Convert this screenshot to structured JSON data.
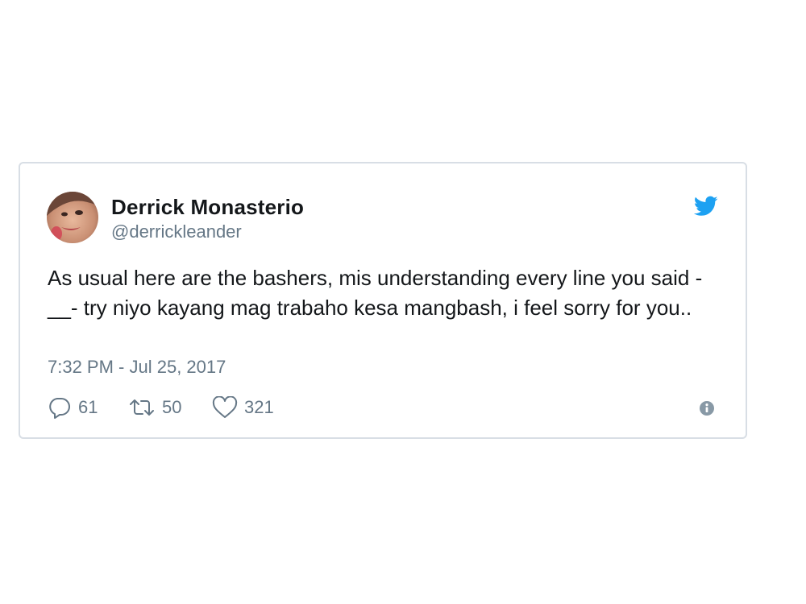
{
  "tweet": {
    "author_name": "Derrick Monasterio",
    "author_handle": "@derrickleander",
    "text": "As usual here are the bashers, mis understanding every line you said -__- try niyo kayang mag trabaho kesa mangbash, i feel sorry for you..",
    "timestamp": "7:32 PM - Jul 25, 2017",
    "replies": "61",
    "retweets": "50",
    "likes": "321"
  },
  "icons": {
    "logo": "twitter-bird-icon",
    "reply": "reply-icon",
    "retweet": "retweet-icon",
    "like": "heart-icon",
    "info": "info-icon"
  },
  "colors": {
    "brand": "#1da1f2",
    "text": "#14171a",
    "muted": "#657786",
    "border": "#d8dee5"
  }
}
